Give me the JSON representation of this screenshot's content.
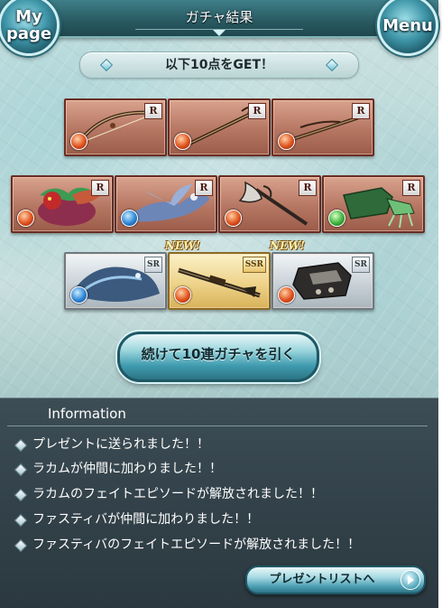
{
  "header": {
    "title": "ガチャ結果",
    "mypage_label_1": "My",
    "mypage_label_2": "page",
    "menu_label": "Menu"
  },
  "banner": {
    "text": "以下10点をGET！"
  },
  "results": {
    "row1": [
      {
        "rarity": "R",
        "element": "fire",
        "item_icon": "bow-icon"
      },
      {
        "rarity": "R",
        "element": "fire",
        "item_icon": "staff-icon"
      },
      {
        "rarity": "R",
        "element": "fire",
        "item_icon": "bow-icon"
      }
    ],
    "row2": [
      {
        "rarity": "R",
        "element": "fire",
        "item_icon": "dragon-summon-icon"
      },
      {
        "rarity": "R",
        "element": "water",
        "item_icon": "wyvern-summon-icon"
      },
      {
        "rarity": "R",
        "element": "fire",
        "item_icon": "axe-icon"
      },
      {
        "rarity": "R",
        "element": "wind",
        "item_icon": "gauntlet-icon"
      }
    ],
    "row3": [
      {
        "rarity": "SR",
        "element": "water",
        "item_icon": "sea-dragon-summon-icon"
      },
      {
        "rarity": "SSR",
        "element": "fire",
        "item_icon": "rifle-icon",
        "new": "NEW!"
      },
      {
        "rarity": "SR",
        "element": "fire",
        "item_icon": "fist-weapon-icon",
        "new": "NEW!"
      }
    ]
  },
  "actions": {
    "draw_again": "続けて10連ガチャを引く"
  },
  "info": {
    "title": "Information",
    "items": [
      "プレゼントに送られました！！",
      "ラカムが仲間に加わりました！！",
      "ラカムのフェイトエピソードが解放されました！！",
      "ファスティバが仲間に加わりました！！",
      "ファスティバのフェイトエピソードが解放されました！！"
    ],
    "present_list_button": "プレゼントリストへ"
  },
  "colors": {
    "header": "#2a5c64",
    "info_panel": "#33424a",
    "r_card": "#b57662",
    "sr_card": "#c9d2d8",
    "ssr_card": "#eed38a",
    "fire": "#e0521e",
    "water": "#2f86d6",
    "wind": "#3fb33d"
  }
}
